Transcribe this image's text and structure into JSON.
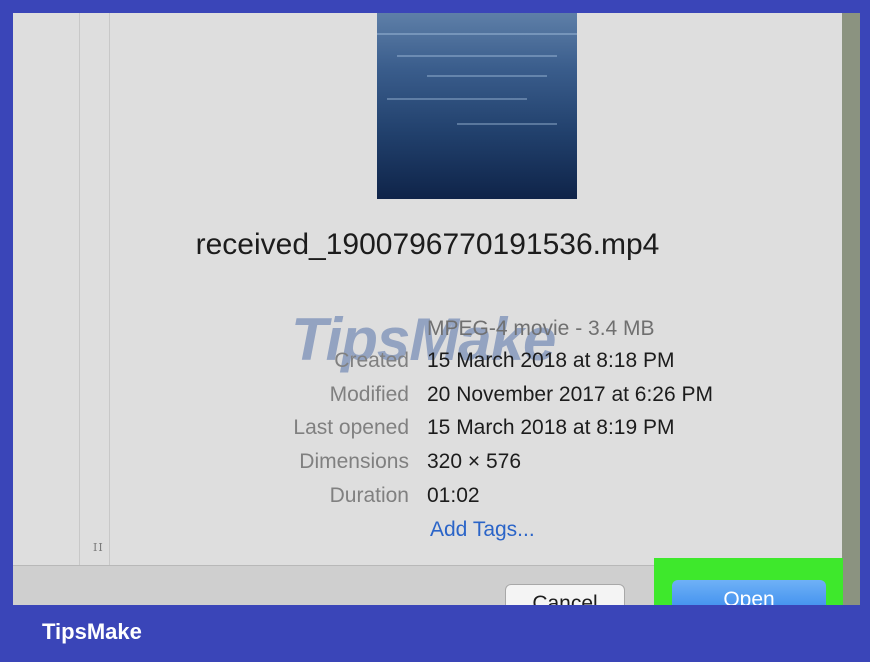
{
  "file": {
    "name": "received_1900796770191536.mp4",
    "kind": "MPEG-4 movie - 3.4 MB"
  },
  "info": [
    {
      "key": "Created",
      "value": "15 March 2018 at 8:18 PM"
    },
    {
      "key": "Modified",
      "value": "20 November 2017 at 6:26 PM"
    },
    {
      "key": "Last opened",
      "value": "15 March 2018 at 8:19 PM"
    },
    {
      "key": "Dimensions",
      "value": "320 × 576"
    },
    {
      "key": "Duration",
      "value": "01:02"
    }
  ],
  "add_tags": "Add Tags...",
  "buttons": {
    "cancel": "Cancel",
    "open": "Open"
  },
  "brand": "TipsMake",
  "watermark": "TipsMake",
  "resize_handle": "II",
  "colors": {
    "highlight": "#3ee82c",
    "open_button": "#2f84ec",
    "brand_bar": "#3a45b8"
  }
}
